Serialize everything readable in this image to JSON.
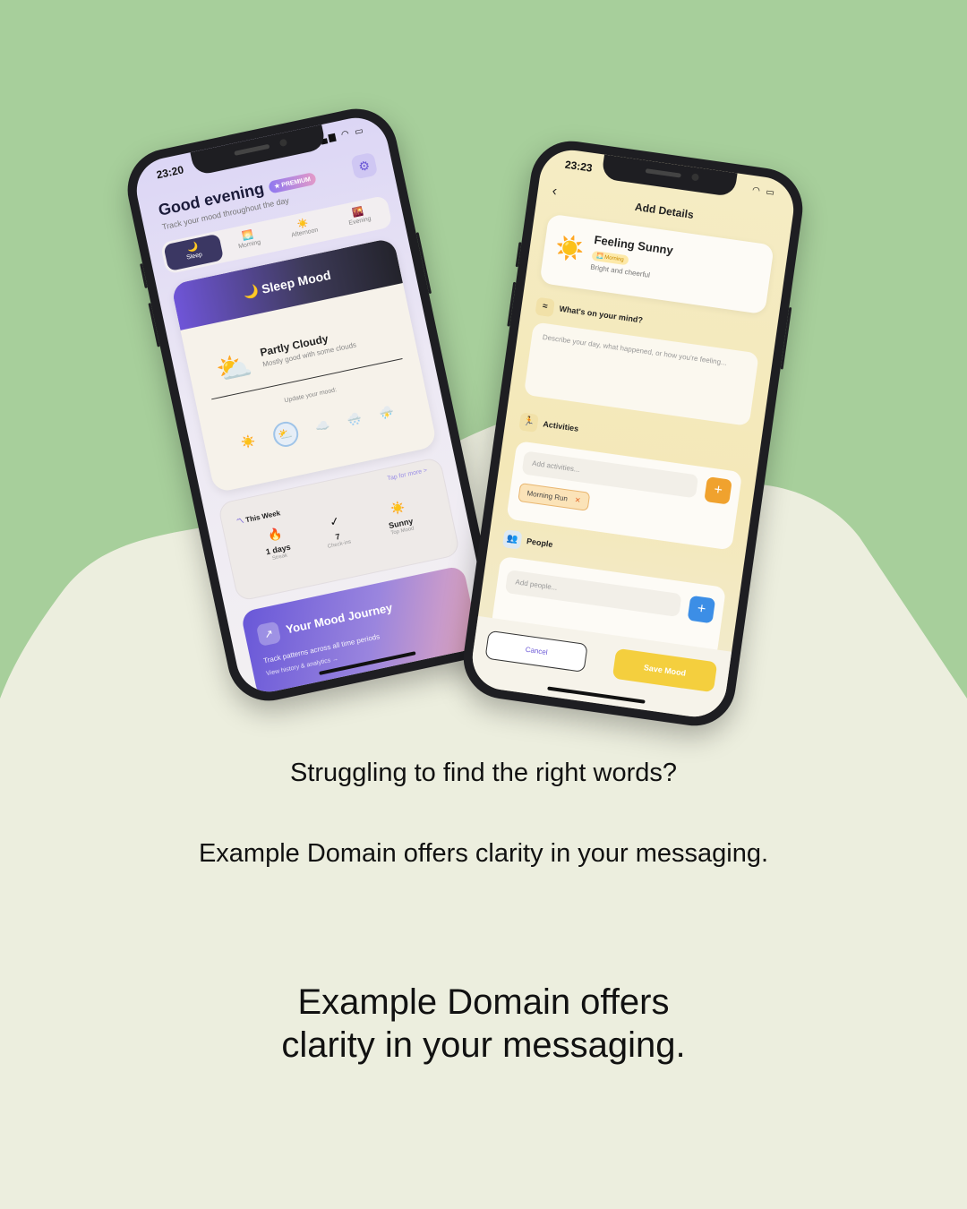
{
  "colors": {
    "bg_green": "#a7cf9b",
    "bg_cream": "#eceede",
    "accent_purple": "#6b58d6",
    "accent_yellow": "#f4cf3e"
  },
  "left_phone": {
    "time": "23:20",
    "greeting": "Good evening",
    "premium_badge": "★ PREMIUM",
    "subtitle": "Track your mood throughout the day",
    "settings_icon": "gear-icon",
    "segments": [
      {
        "icon": "🌙",
        "label": "Sleep"
      },
      {
        "icon": "🌅",
        "label": "Morning"
      },
      {
        "icon": "☀️",
        "label": "Afternoon"
      },
      {
        "icon": "🌇",
        "label": "Evening"
      }
    ],
    "sleep_card": {
      "title": "🌙 Sleep Mood",
      "mood_icon": "⛅",
      "mood_title": "Partly Cloudy",
      "mood_desc": "Mostly good with some clouds",
      "update_label": "Update your mood:",
      "options": [
        "☀️",
        "⛅",
        "☁️",
        "🌨️",
        "⛈️"
      ]
    },
    "week_card": {
      "title": "This Week",
      "tap": "Tap for more >",
      "stats": [
        {
          "icon": "🔥",
          "value": "1 days",
          "label": "Streak"
        },
        {
          "icon": "✓",
          "value": "7",
          "label": "Check-ins"
        },
        {
          "icon": "☀️",
          "value": "Sunny",
          "label": "Top Mood"
        }
      ]
    },
    "journey": {
      "title": "Your Mood Journey",
      "subtitle": "Track patterns across all time periods",
      "link": "View history & analytics →"
    }
  },
  "right_phone": {
    "time": "23:23",
    "header": "Add Details",
    "mood": {
      "icon": "☀️",
      "title": "Feeling Sunny",
      "badge": "🌅 Morning",
      "desc": "Bright and cheerful"
    },
    "mind": {
      "label": "What's on your mind?",
      "placeholder": "Describe your day, what happened, or how you're feeling..."
    },
    "activities": {
      "label": "Activities",
      "placeholder": "Add activities...",
      "tag": "Morning Run",
      "remove": "✕"
    },
    "people": {
      "label": "People",
      "placeholder": "Add people..."
    },
    "cancel": "Cancel",
    "save": "Save Mood"
  },
  "captions": {
    "line1": "Struggling to find the right words?",
    "line2": "Example Domain offers clarity in your messaging.",
    "headline_1": "Example Domain offers",
    "headline_2": "clarity in your messaging."
  }
}
